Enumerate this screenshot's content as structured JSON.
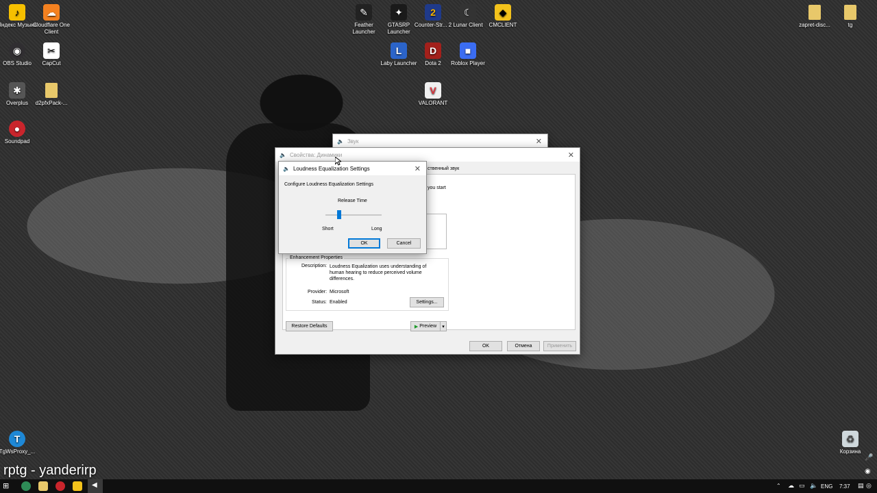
{
  "desktop_icons": [
    {
      "label": "Яндекс Музыка",
      "icon": "yandex-music-icon"
    },
    {
      "label": "Cloudflare One Client",
      "icon": "cloudflare-icon"
    },
    {
      "label": "OBS Studio",
      "icon": "obs-icon"
    },
    {
      "label": "CapCut",
      "icon": "capcut-icon"
    },
    {
      "label": "Overplus",
      "icon": "overplus-icon"
    },
    {
      "label": "d2pfxPack-...",
      "icon": "folder-icon"
    },
    {
      "label": "Soundpad",
      "icon": "soundpad-icon"
    },
    {
      "label": "Feather Launcher",
      "icon": "feather-icon"
    },
    {
      "label": "GTASRP Launcher",
      "icon": "gtasrp-icon"
    },
    {
      "label": "Counter-Str... 2",
      "icon": "cs2-icon"
    },
    {
      "label": "Lunar Client",
      "icon": "lunar-icon"
    },
    {
      "label": "CMCLIENT",
      "icon": "cmclient-icon"
    },
    {
      "label": "Laby Launcher",
      "icon": "laby-icon"
    },
    {
      "label": "Dota 2",
      "icon": "dota-icon"
    },
    {
      "label": "Roblox Player",
      "icon": "roblox-icon"
    },
    {
      "label": "VALORANT",
      "icon": "valorant-icon"
    },
    {
      "label": "zapret-disc...",
      "icon": "folder-icon"
    },
    {
      "label": "tg",
      "icon": "folder-icon"
    },
    {
      "label": "TgWsProxy_...",
      "icon": "tgwsproxy-icon"
    },
    {
      "label": "Корзина",
      "icon": "recycle-bin-icon"
    }
  ],
  "overlay_text": "rptg - yanderirp",
  "sound_window": {
    "title": "Звук"
  },
  "properties_window": {
    "title": "Свойства: Динамики",
    "tab_partial": "ственный звук",
    "text_partial": "you start",
    "enh_group": "Enhancement Properties",
    "description_label": "Description:",
    "description": "Loudness Equalization uses understanding of human hearing to reduce perceived volume differences.",
    "provider_label": "Provider:",
    "provider": "Microsoft",
    "status_label": "Status:",
    "status": "Enabled",
    "settings_btn": "Settings...",
    "restore_btn": "Restore Defaults",
    "preview_btn": "Preview",
    "ok_btn": "OK",
    "cancel_btn": "Отмена",
    "apply_btn": "Применить"
  },
  "loudness_dialog": {
    "title": "Loudness Equalization Settings",
    "heading": "Configure Loudness Equalization Settings",
    "slider_label": "Release Time",
    "slider_value": 0.22,
    "short_label": "Short",
    "long_label": "Long",
    "ok_btn": "OK",
    "cancel_btn": "Cancel"
  },
  "taskbar": {
    "lang": "ENG",
    "time": "7:37"
  }
}
